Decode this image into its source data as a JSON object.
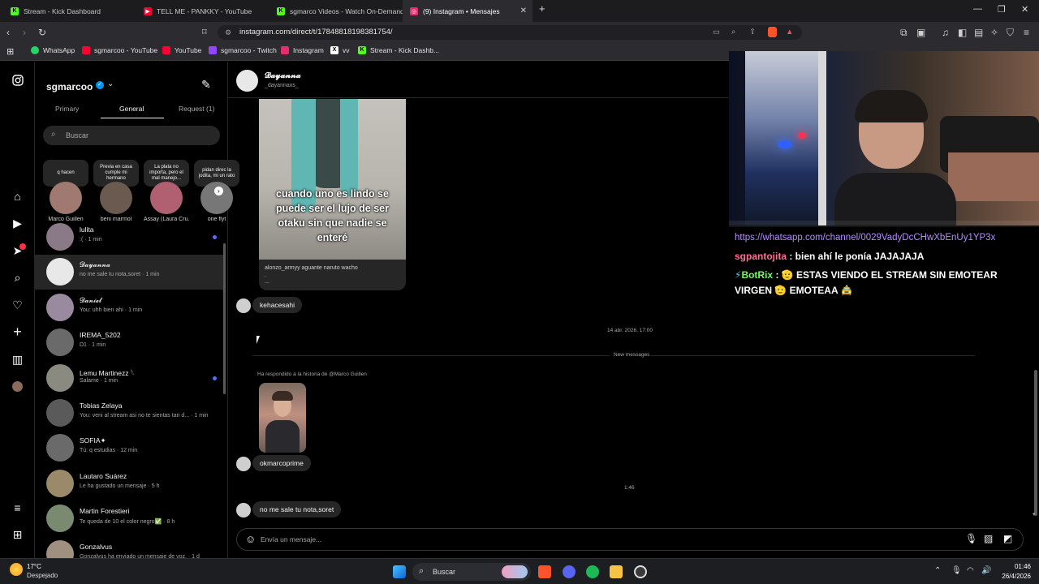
{
  "browser": {
    "tabs": [
      {
        "title": "Stream - Kick Dashboard",
        "color": "#53fc18",
        "icon": "K"
      },
      {
        "title": "TELL ME - PANKKY - YouTube",
        "color": "#ff0033",
        "icon": "▶"
      },
      {
        "title": "sgmarco Videos - Watch On-Demand",
        "color": "#53fc18",
        "icon": "K"
      },
      {
        "title": "(9) Instagram • Mensajes",
        "color": "#e1306c",
        "icon": "◎"
      }
    ],
    "url": "instagram.com/direct/t/17848818198381754/",
    "bookmarks": [
      {
        "label": "WhatsApp",
        "color": "#25d366"
      },
      {
        "label": "sgmarcoo - YouTube",
        "color": "#ff0033"
      },
      {
        "label": "YouTube",
        "color": "#ff0033"
      },
      {
        "label": "sgmarcoo - Twitch",
        "color": "#9146ff"
      },
      {
        "label": "Instagram",
        "color": "#e1306c"
      },
      {
        "label": "vv",
        "color": "#ffffff"
      },
      {
        "label": "Stream - Kick Dashb...",
        "color": "#53fc18"
      }
    ]
  },
  "inbox": {
    "username": "sgmarcoo",
    "tabs": [
      "Primary",
      "General",
      "Request (1)"
    ],
    "search_placeholder": "Buscar",
    "notes": [
      {
        "text": "q hacen",
        "name": "Marco Guillen",
        "color": "#a07a70"
      },
      {
        "text": "Previa en casa cumple mi hermano",
        "name": "beni marmol",
        "color": "#6a5a50"
      },
      {
        "text": "La plata no importa, pero el mal manejo...",
        "name": "Assay (Laura Cru...",
        "color": "#b06070"
      },
      {
        "text": "pidan direc la jodita, mi un rato",
        "name": "one flyt",
        "color": "#777777"
      }
    ],
    "conversations": [
      {
        "name": "lulita",
        "preview": ":( · 1 min",
        "unread": true,
        "color": "#8a7a88"
      },
      {
        "name": "𝓓𝓪𝔂𝓪𝓷𝓷𝓪",
        "preview": "no me sale tu nota,soret · 1 min",
        "unread": false,
        "color": "#e8e8e8"
      },
      {
        "name": "𝓓𝓪𝓷𝓲𝓮𝓵",
        "preview": "You: uhh bien ahi · 1 min",
        "unread": false,
        "color": "#9a8aa0"
      },
      {
        "name": "IREMA_5202",
        "preview": "D1 · 1 min",
        "unread": false,
        "color": "#6a6a6a"
      },
      {
        "name": "Lemu Martinezz 𓆩",
        "preview": "Salame · 1 min",
        "unread": true,
        "color": "#8a8a80"
      },
      {
        "name": "Tobias Zelaya",
        "preview": "You: veni al stream asi no te sientas tan d... · 1 min",
        "unread": false,
        "color": "#5a5a5a"
      },
      {
        "name": "SOFIA✦",
        "preview": "Tú: q estudias · 12 min",
        "unread": false,
        "color": "#6a6a6a"
      },
      {
        "name": "Lautaro Suárez",
        "preview": "Le ha gustado un mensaje · 5 h",
        "unread": false,
        "color": "#9a8a6a"
      },
      {
        "name": "Martin Forestieri",
        "preview": "Te queda de 10 el color negro✅ · 8 h",
        "unread": false,
        "color": "#7a8a70"
      },
      {
        "name": "Gonzalvus",
        "preview": "Gonzalvus ha enviado un mensaje de voz. · 1 d",
        "unread": false,
        "color": "#a09080"
      }
    ]
  },
  "thread": {
    "name": "𝓓𝓪𝔂𝓪𝓷𝓷𝓪",
    "handle": "_dayannaxs_",
    "shared_post_caption": "cuando uno es lindo se puede ser el lujo de ser otaku sin que nadie se enteré",
    "shared_post_author": "alonzo_armyy aguante naruto wacho",
    "shared_post_dots": ".",
    "shared_post_ellipsis": "...",
    "msg1": "kehacesahi",
    "date_sep": "14 abr. 2026, 17:00",
    "new_messages": "New messages",
    "story_reply": "Ha respondido a la historia de @Marco Guillen",
    "msg2": "okmarcoprime",
    "time_sep": "1:46",
    "msg3": "no me sale tu nota,soret",
    "input_placeholder": "Envía un mensaje..."
  },
  "overlay": {
    "chat": [
      {
        "user": "",
        "text": "https://whatsapp.com/channel/0029VadyDcCHwXbEnUy1YP3x",
        "color": "#b48cff"
      },
      {
        "user": "sgpantojita",
        "text": " : bien ahí le ponía JAJAJAJA",
        "color": "#ff6f91"
      },
      {
        "user": "BotRix",
        "text": " : 🫡 ESTAS VIENDO EL STREAM SIN EMOTEAR",
        "color": "#6dff5a"
      },
      {
        "user": "",
        "text": "VIRGEN 🫡 EMOTEAA 🚖",
        "color": "#ffffff"
      }
    ]
  },
  "taskbar": {
    "temp": "17°C",
    "weather": "Despejado",
    "search": "Buscar",
    "time": "01:46",
    "date": "26/4/2026"
  }
}
